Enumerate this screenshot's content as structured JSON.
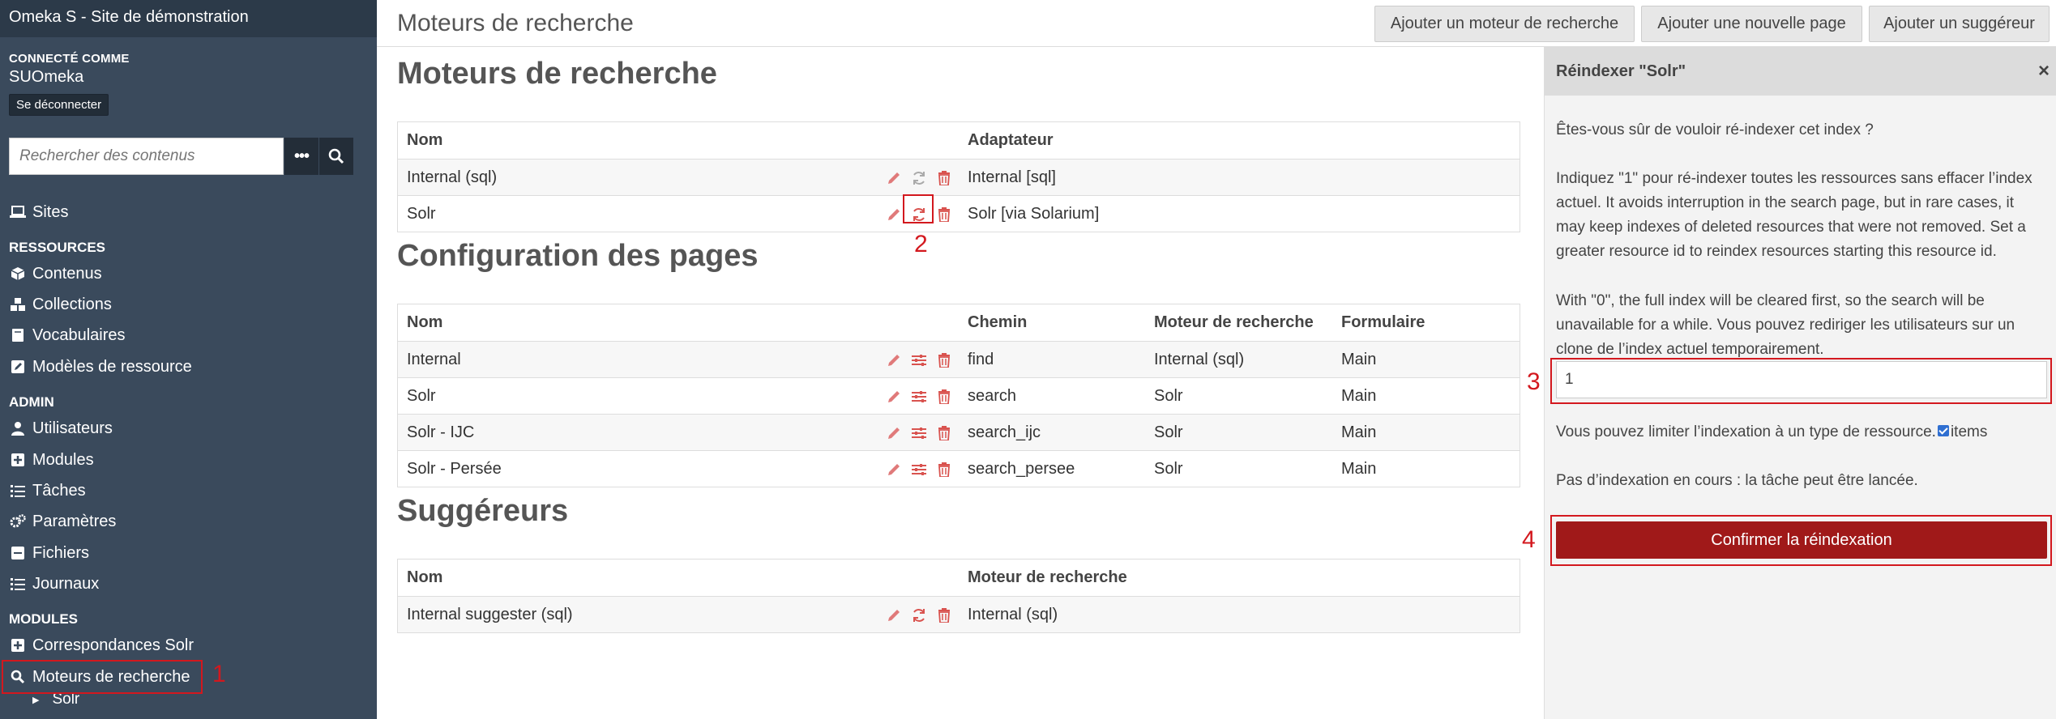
{
  "sidebar": {
    "site_title": "Omeka S - Site de démonstration",
    "login_label": "Connecté comme",
    "user": "SUOmeka",
    "logout": "Se déconnecter",
    "search_placeholder": "Rechercher des contenus",
    "sites": "Sites",
    "resources_head": "Ressources",
    "contenus": "Contenus",
    "collections": "Collections",
    "vocabulaires": "Vocabulaires",
    "modeles": "Modèles de ressource",
    "admin_head": "Admin",
    "utilisateurs": "Utilisateurs",
    "modules": "Modules",
    "taches": "Tâches",
    "parametres": "Paramètres",
    "fichiers": "Fichiers",
    "journaux": "Journaux",
    "modules_head": "Modules",
    "correspondances": "Correspondances Solr",
    "moteurs": "Moteurs de recherche",
    "solr_sub": "Solr"
  },
  "annotations": {
    "n1": "1",
    "n2": "2",
    "n3": "3",
    "n4": "4"
  },
  "topbar": {
    "title": "Moteurs de recherche",
    "btn_add_engine": "Ajouter un moteur de recherche",
    "btn_add_page": "Ajouter une nouvelle page",
    "btn_add_suggester": "Ajouter un suggéreur"
  },
  "engines": {
    "heading": "Moteurs de recherche",
    "col_name": "Nom",
    "col_adapter": "Adaptateur",
    "rows": [
      {
        "name": "Internal (sql)",
        "adapter": "Internal [sql]"
      },
      {
        "name": "Solr",
        "adapter": "Solr [via Solarium]"
      }
    ]
  },
  "pages": {
    "heading": "Configuration des pages",
    "col_name": "Nom",
    "col_path": "Chemin",
    "col_engine": "Moteur de recherche",
    "col_form": "Formulaire",
    "rows": [
      {
        "name": "Internal",
        "path": "find",
        "engine": "Internal (sql)",
        "form": "Main"
      },
      {
        "name": "Solr",
        "path": "search",
        "engine": "Solr",
        "form": "Main"
      },
      {
        "name": "Solr - IJC",
        "path": "search_ijc",
        "engine": "Solr",
        "form": "Main"
      },
      {
        "name": "Solr - Persée",
        "path": "search_persee",
        "engine": "Solr",
        "form": "Main"
      }
    ]
  },
  "suggesters": {
    "heading": "Suggéreurs",
    "col_name": "Nom",
    "col_engine": "Moteur de recherche",
    "rows": [
      {
        "name": "Internal suggester (sql)",
        "engine": "Internal (sql)"
      }
    ]
  },
  "panel": {
    "title": "Réindexer \"Solr\"",
    "close": "×",
    "q1": "Êtes-vous sûr de vouloir ré-indexer cet index ?",
    "p1": "Indiquez \"1\" pour ré-indexer toutes les ressources sans effacer l’index actuel. It avoids interruption in the search page, but in rare cases, it may keep indexes of deleted resources that were not removed. Set a greater resource id to reindex resources starting this resource id.",
    "p2": "With \"0\", the full index will be cleared first, so the search will be unavailable for a while. Vous pouvez rediriger les utilisateurs sur un clone de l’index actuel temporairement.",
    "input_value": "1",
    "limit_text": "Vous pouvez limiter l’indexation à un type de ressource.",
    "limit_option": "items",
    "status": "Pas d’indexation en cours : la tâche peut être lancée.",
    "confirm": "Confirmer la réindexation"
  }
}
